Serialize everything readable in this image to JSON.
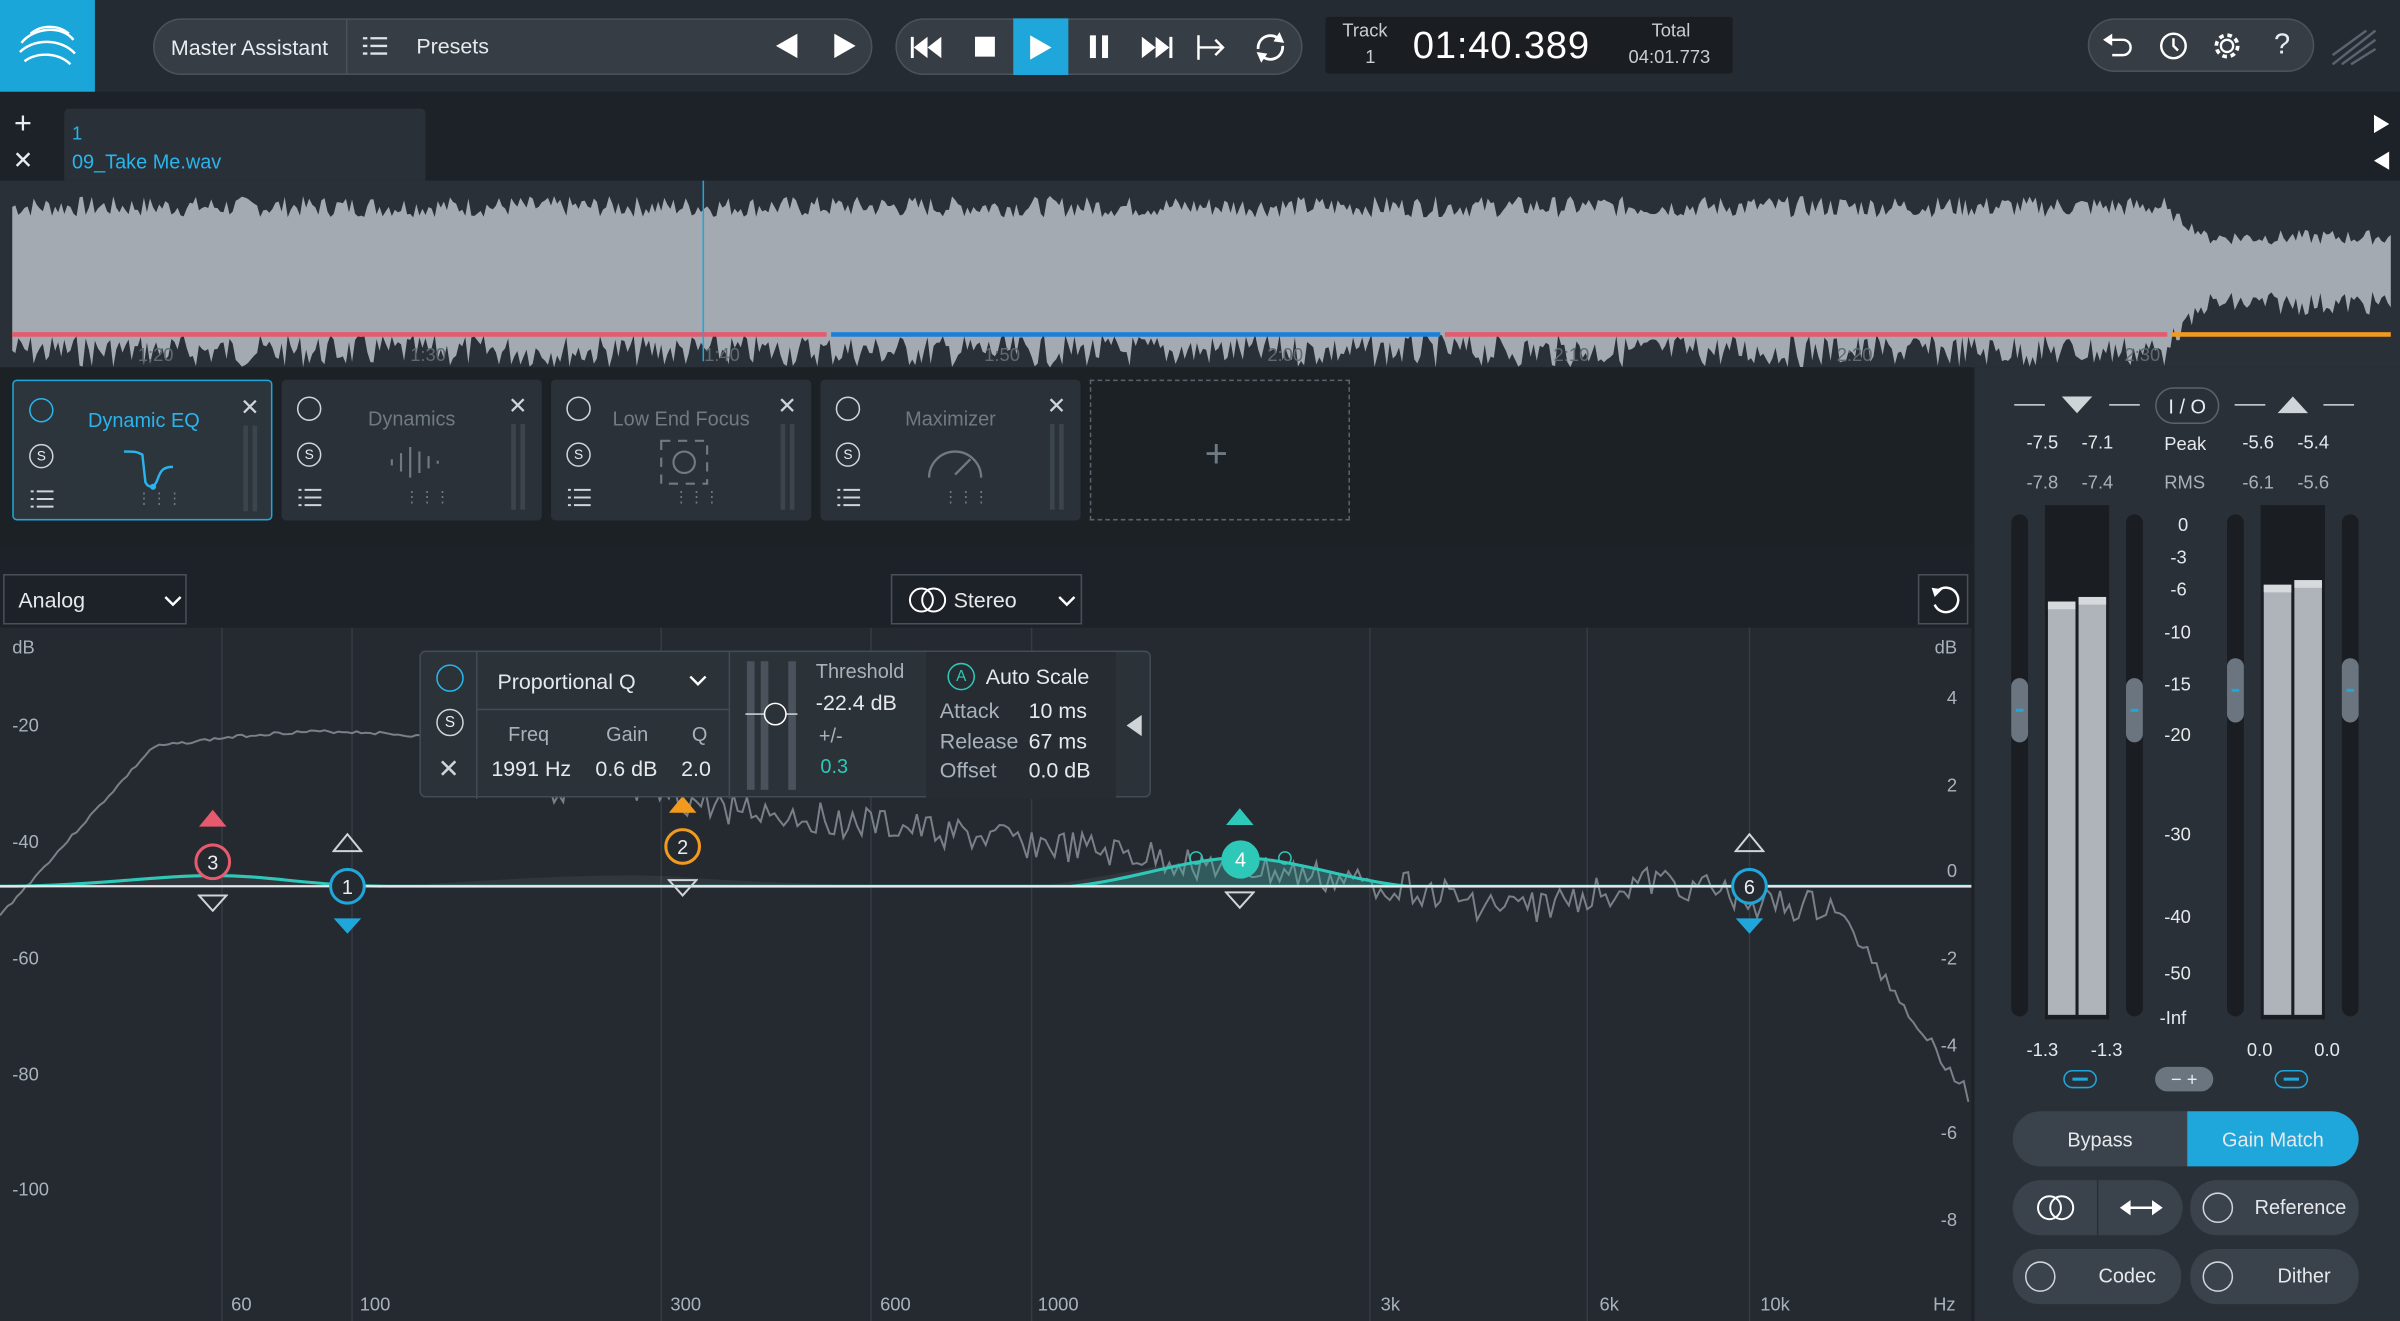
{
  "transport": {
    "assistant": "Master Assistant",
    "presets": "Presets",
    "track_label": "Track",
    "track_num": "1",
    "time": "01:40.389",
    "total_label": "Total",
    "total_time": "04:01.773"
  },
  "track_tab": {
    "number": "1",
    "file": "09_Take Me.wav"
  },
  "timeline": {
    "ticks": [
      "1:20",
      "1:30",
      "1:40",
      "1:50",
      "2:00",
      "2:10",
      "2:20",
      "2:30"
    ],
    "playhead_time": "1:40"
  },
  "modules": [
    {
      "name": "Dynamic EQ",
      "selected": true
    },
    {
      "name": "Dynamics",
      "selected": false
    },
    {
      "name": "Low End Focus",
      "selected": false
    },
    {
      "name": "Maximizer",
      "selected": false
    }
  ],
  "eq": {
    "mode": "Analog",
    "channel": "Stereo",
    "db_label_left": "dB",
    "db_label_right": "dB",
    "left_axis": [
      "-20",
      "-40",
      "-60",
      "-80",
      "-100"
    ],
    "right_axis": [
      "4",
      "2",
      "0",
      "-2",
      "-4",
      "-6",
      "-8"
    ],
    "freq_axis": [
      "60",
      "100",
      "300",
      "600",
      "1000",
      "3k",
      "6k",
      "10k",
      "Hz"
    ],
    "nodes": [
      "1",
      "2",
      "3",
      "4",
      "6"
    ]
  },
  "band_popup": {
    "type": "Proportional Q",
    "freq_label": "Freq",
    "freq": "1991 Hz",
    "gain_label": "Gain",
    "gain": "0.6 dB",
    "q_label": "Q",
    "q": "2.0",
    "threshold_label": "Threshold",
    "threshold": "-22.4 dB",
    "pm_label": "+/-",
    "pm": "0.3",
    "autoscale": "Auto Scale",
    "attack_label": "Attack",
    "attack": "10 ms",
    "release_label": "Release",
    "release": "67 ms",
    "offset_label": "Offset",
    "offset": "0.0 dB"
  },
  "meters": {
    "io": "I / O",
    "peak_label": "Peak",
    "rms_label": "RMS",
    "in_peak": [
      "-7.5",
      "-7.1"
    ],
    "in_rms": [
      "-7.8",
      "-7.4"
    ],
    "out_peak": [
      "-5.6",
      "-5.4"
    ],
    "out_rms": [
      "-6.1",
      "-5.6"
    ],
    "scale": [
      "0",
      "-3",
      "-6",
      "-10",
      "-15",
      "-20",
      "-30",
      "-40",
      "-50",
      "-Inf"
    ],
    "in_gain": [
      "-1.3",
      "-1.3"
    ],
    "out_gain": [
      "0.0",
      "0.0"
    ],
    "bypass": "Bypass",
    "gain_match": "Gain Match",
    "reference": "Reference",
    "codec": "Codec",
    "dither": "Dither"
  },
  "colors": {
    "accent": "#1fa6da",
    "teal": "#2ec8b8",
    "red": "#e55a6e",
    "orange": "#f29a1e",
    "blue": "#1e7fd8"
  }
}
